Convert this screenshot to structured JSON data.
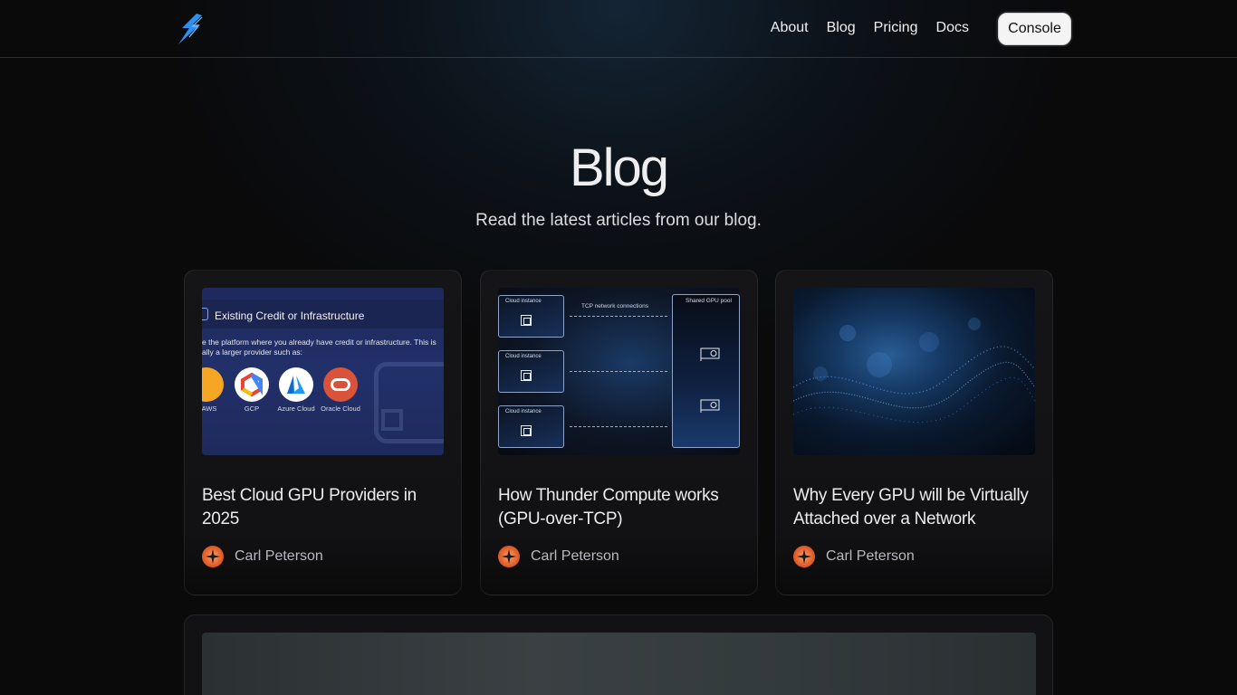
{
  "nav": {
    "items": [
      "About",
      "Blog",
      "Pricing",
      "Docs"
    ],
    "console_label": "Console"
  },
  "hero": {
    "title": "Blog",
    "subtitle": "Read the latest articles from our blog."
  },
  "posts": [
    {
      "title": "Best Cloud GPU Providers in 2025",
      "author": "Carl Peterson",
      "image": {
        "heading": "Existing Credit or Infrastructure",
        "line1": "e the platform where you already have credit or infrastructure. This is",
        "line2": "ally a larger provider such as:",
        "providers": [
          "AWS",
          "GCP",
          "Azure Cloud",
          "Oracle Cloud"
        ]
      }
    },
    {
      "title": "How Thunder Compute works (GPU-over-TCP)",
      "author": "Carl Peterson",
      "image": {
        "instance_label": "Cloud instance",
        "connections_label": "TCP network connections",
        "pool_label": "Shared GPU pool"
      }
    },
    {
      "title": "Why Every GPU will be Virtually Attached over a Network",
      "author": "Carl Peterson"
    }
  ],
  "colors": {
    "background": "#0a0a0b",
    "accent_blue": "#2f8ff0",
    "avatar_orange": "#e4622a"
  }
}
